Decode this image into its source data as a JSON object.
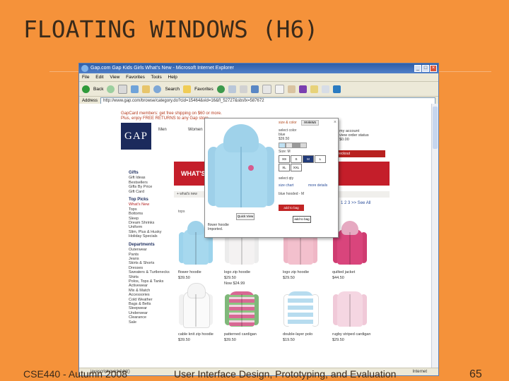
{
  "slide": {
    "title": "FLOATING WINDOWS (H6)",
    "footer_left": "CSE440 - Autumn 2008",
    "footer_center": "User Interface Design, Prototyping, and Evaluation",
    "page_number": "65"
  },
  "browser": {
    "title": "Gap.com  Gap Kids  Girls  What's New - Microsoft Internet Explorer",
    "menu": [
      "File",
      "Edit",
      "View",
      "Favorites",
      "Tools",
      "Help"
    ],
    "toolbar": {
      "back": "Back",
      "search": "Search",
      "favorites": "Favorites"
    },
    "address_label": "Address",
    "address_value": "http://www.gap.com/browse/category.do?cid=15464&vid=16&fl_52727&sbsfx=587672",
    "status_left": "javascript:quickAdd()",
    "status_right": "Internet"
  },
  "page": {
    "promo_line1": "GapCard members: get free shipping on $60 or more.",
    "promo_line2": "Plus, enjoy FREE RETURNS to any Gap store",
    "logo": "GAP",
    "nav": [
      "Men",
      "Women"
    ],
    "hero_text": "WHAT'S N",
    "sub_bar": "+ what's new",
    "pager": "1 2 3 >>   See All",
    "account": [
      "my account",
      "view order status",
      "$0.00"
    ],
    "checkout": "checkout",
    "thumb_caption": "tops",
    "sidebar": {
      "groups": [
        {
          "heading": "Gifts",
          "items": [
            "Gift Ideas",
            "Bestsellers",
            "Gifts By Price",
            "Gift Card"
          ]
        },
        {
          "heading": "Top Picks",
          "items": [
            "What's New",
            "Tops",
            "Bottoms",
            "Sleep",
            "Dream Shrinks",
            "Uniform",
            "Slim, Plus & Husky",
            "Holiday Specials"
          ]
        },
        {
          "heading": "Departments",
          "items": [
            "Outerwear",
            "Pants",
            "Jeans",
            "Skirts & Shorts",
            "Dresses",
            "Sweaters & Turtlenecks",
            "Shirts",
            "Polos, Tops & Tanks",
            "Activewear",
            "Mix & Match",
            "Accessories",
            "Cold Weather",
            "Bags & Belts",
            "Sleepwear",
            "Underwear",
            "Clearance",
            "Sale"
          ]
        }
      ],
      "selected": "What's New"
    },
    "products": [
      {
        "name": "flower hoodie",
        "price": "$39.50",
        "color": "#a6d8ee"
      },
      {
        "name": "logo zip hoodie",
        "price": "$29.50",
        "price2": "Now $24.99",
        "color": "#f4f2f2"
      },
      {
        "name": "logo zip hoodie",
        "price": "$29.50",
        "color": "#f3c0cd"
      },
      {
        "name": "quilted jacket",
        "price": "$44.50",
        "color": "#d9457c"
      },
      {
        "name": "cable knit zip hoodie",
        "price": "$39.50",
        "color": "#ffffff"
      },
      {
        "name": "patterned cardigan",
        "price": "$39.50",
        "color": "#d86894"
      },
      {
        "name": "double-layer polo",
        "price": "$19.50",
        "color": "#b7dcef"
      },
      {
        "name": "rugby striped cardigan",
        "price": "$29.50",
        "color": "#f0c9d8"
      }
    ],
    "popup": {
      "tab_selected": "size & color",
      "tab_review": "reviews",
      "select_color": "select color",
      "color_value": "blue",
      "price": "$39.50",
      "select_size_label": "select size",
      "size_label": "Size: M",
      "sizes": [
        "XS",
        "S",
        "M",
        "L",
        "XL",
        "XXL"
      ],
      "selected_size": "M",
      "qty_label": "select qty",
      "size_chart": "size chart",
      "more_details": "more details",
      "selection_summary": "blue hooded - M",
      "add_to_bag": "add to bag",
      "quick_add": "add to bag",
      "quick_view": "Quick View",
      "desc_title": "flower hoodie",
      "desc_sub": "Imported.",
      "swatches": [
        "#bfe0f2",
        "#e4e4e4",
        "#9a9a9a",
        "#d8d8d8"
      ]
    }
  }
}
